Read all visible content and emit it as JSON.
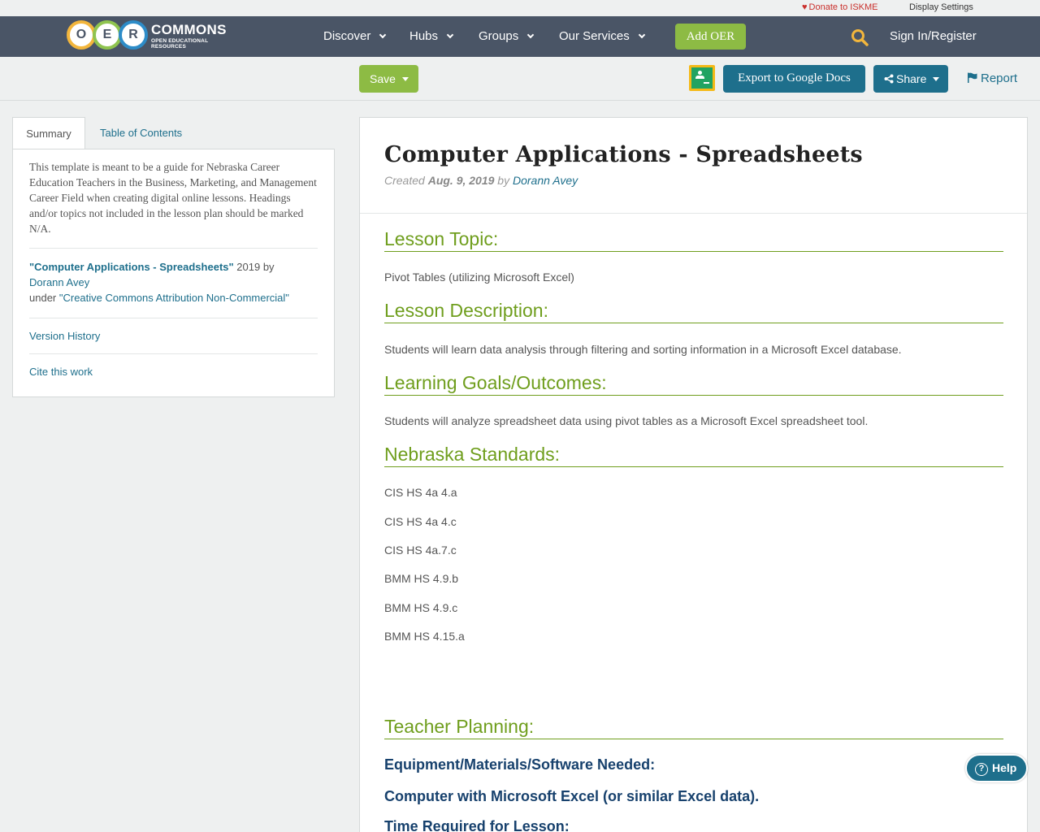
{
  "utility": {
    "donate": "Donate to ISKME",
    "display_settings": "Display Settings"
  },
  "nav": {
    "logo": {
      "letters": [
        "O",
        "E",
        "R"
      ],
      "word": "COMMONS",
      "sub": "OPEN EDUCATIONAL RESOURCES"
    },
    "items": [
      "Discover",
      "Hubs",
      "Groups",
      "Our Services"
    ],
    "add_oer": "Add OER",
    "sign_in": "Sign In/Register"
  },
  "toolbar": {
    "save": "Save",
    "export": "Export to Google Docs",
    "share": "Share",
    "report": "Report"
  },
  "sidebar": {
    "tabs": [
      "Summary",
      "Table of Contents"
    ],
    "summary": "This template is meant to be a guide for Nebraska Career Education Teachers in the Business, Marketing, and Management Career Field when creating digital online lessons. Headings and/or topics not included in the lesson plan should be marked N/A.",
    "license": {
      "title": "\"Computer Applications - Spreadsheets\"",
      "year_by": " 2019 by",
      "author": "Dorann Avey",
      "under": "under ",
      "license_name": "\"Creative Commons Attribution Non-Commercial\""
    },
    "version_history": "Version History",
    "cite": "Cite this work"
  },
  "main": {
    "title": "Computer Applications - Spreadsheets",
    "created_label": "Created ",
    "created_date": "Aug. 9, 2019",
    "by": " by ",
    "author": "Dorann Avey",
    "sections": {
      "topic_h": "Lesson Topic:",
      "topic": "Pivot Tables (utilizing Microsoft Excel)",
      "desc_h": "Lesson Description:",
      "desc": "Students will learn data analysis through filtering and sorting information in a Microsoft Excel database.",
      "goals_h": "Learning Goals/Outcomes:",
      "goals": "Students will analyze spreadsheet data using pivot tables as a Microsoft Excel spreadsheet tool.",
      "standards_h": "Nebraska Standards:",
      "standards": [
        "CIS HS 4a 4.a",
        "CIS HS 4a 4.c",
        "CIS HS 4a.7.c",
        "BMM HS 4.9.b",
        "BMM HS 4.9.c",
        "BMM HS 4.15.a"
      ],
      "planning_h": "Teacher Planning:",
      "equipment": "Equipment/Materials/Software Needed:",
      "computer": "Computer with Microsoft Excel (or similar Excel data).",
      "time": "Time Required for Lesson:"
    }
  },
  "help": "Help"
}
